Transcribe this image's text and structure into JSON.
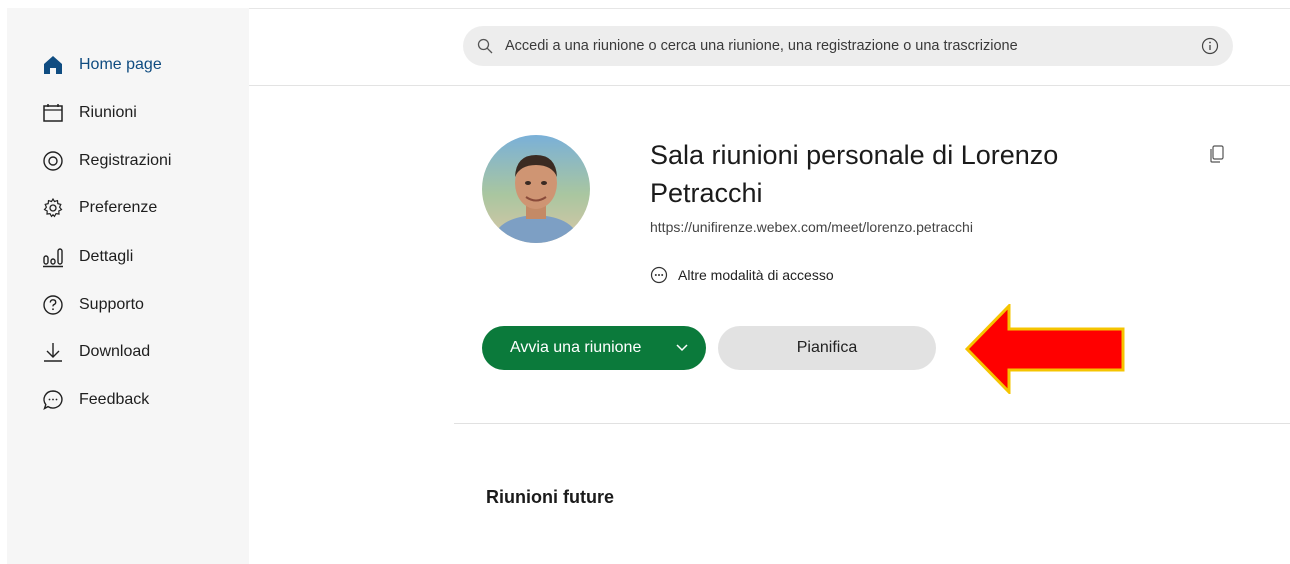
{
  "sidebar": {
    "items": [
      {
        "label": "Home page",
        "icon": "home-icon"
      },
      {
        "label": "Riunioni",
        "icon": "calendar-icon"
      },
      {
        "label": "Registrazioni",
        "icon": "recording-icon"
      },
      {
        "label": "Preferenze",
        "icon": "gear-icon"
      },
      {
        "label": "Dettagli",
        "icon": "analytics-icon"
      },
      {
        "label": "Supporto",
        "icon": "help-icon"
      },
      {
        "label": "Download",
        "icon": "download-icon"
      },
      {
        "label": "Feedback",
        "icon": "feedback-icon"
      }
    ],
    "active_color": "#0f4c81"
  },
  "search": {
    "placeholder": "Accedi a una riunione o cerca una riunione, una registrazione o una trascrizione"
  },
  "room": {
    "title": "Sala riunioni personale di Lorenzo Petracchi",
    "url": "https://unifirenze.webex.com/meet/lorenzo.petracchi",
    "alt_access_label": "Altre modalità di accesso"
  },
  "actions": {
    "start_label": "Avvia una riunione",
    "schedule_label": "Pianifica",
    "start_color": "#0b7a3b"
  },
  "upcoming": {
    "heading": "Riunioni future"
  },
  "annotation": {
    "arrow_color": "#ff0000",
    "arrow_outline": "#f5c400"
  }
}
